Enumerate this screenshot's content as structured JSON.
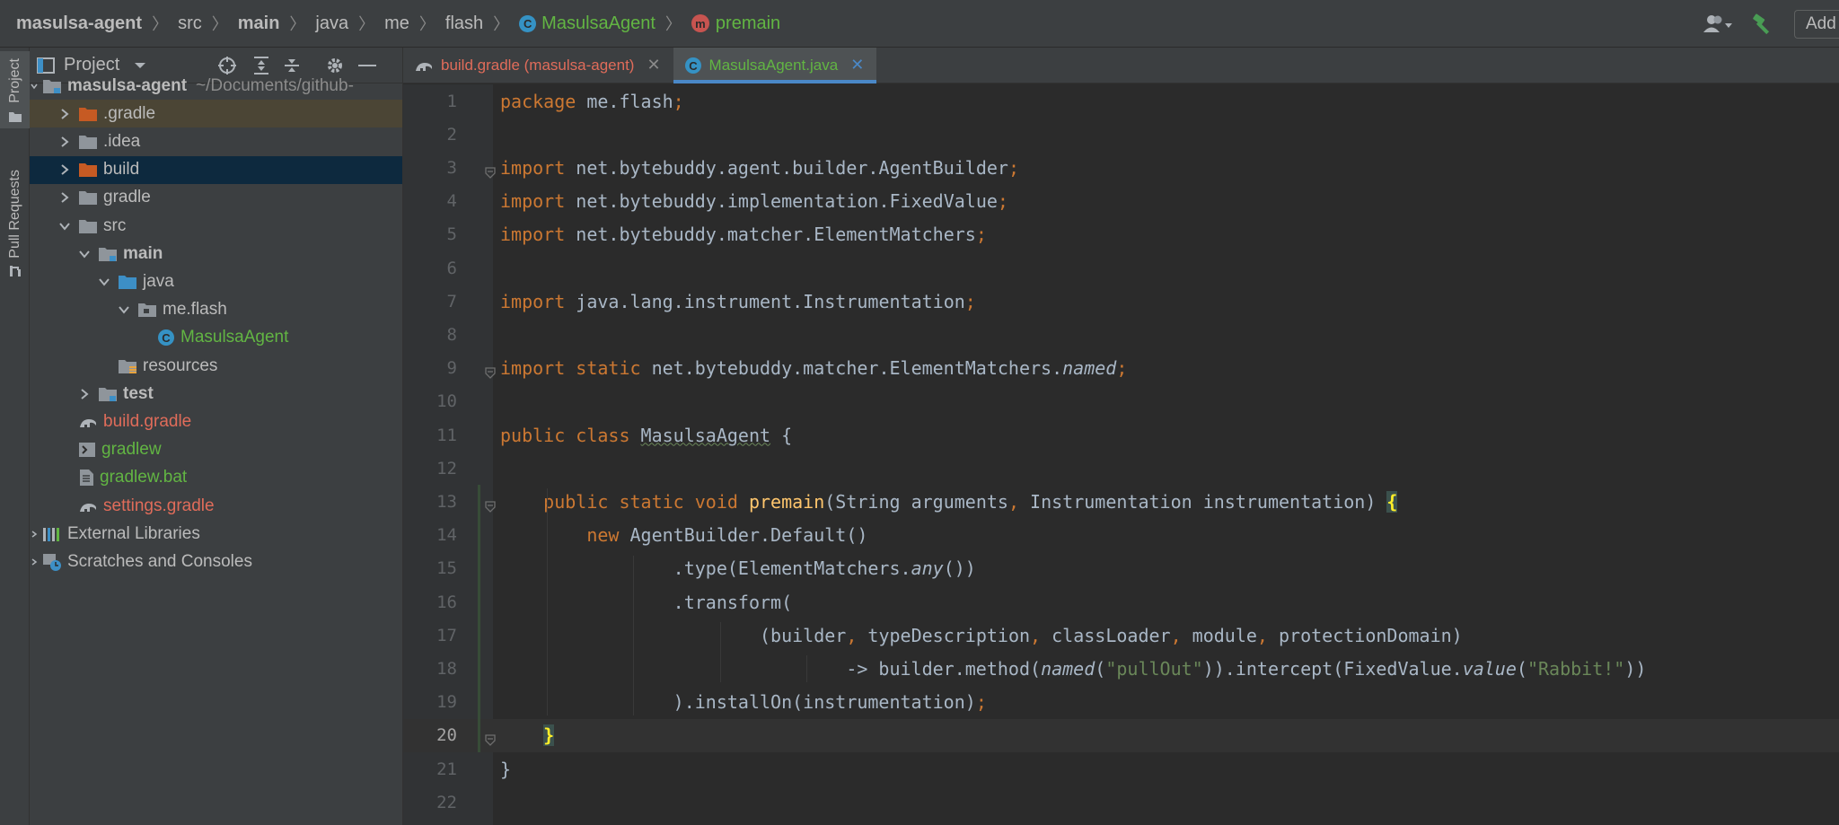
{
  "breadcrumbs": [
    {
      "label": "masulsa-agent",
      "style": "bold"
    },
    {
      "label": "src",
      "style": "normal"
    },
    {
      "label": "main",
      "style": "bold"
    },
    {
      "label": "java",
      "style": "normal"
    },
    {
      "label": "me",
      "style": "normal"
    },
    {
      "label": "flash",
      "style": "normal"
    },
    {
      "label": "MasulsaAgent",
      "style": "class",
      "badge": "C"
    },
    {
      "label": "premain",
      "style": "method",
      "badge": "m"
    }
  ],
  "toolbar": {
    "add_configuration_label": "Add C",
    "user_icon": "user-dropdown-icon",
    "build_icon": "hammer-icon"
  },
  "tool_strip": {
    "project_label": "Project",
    "pull_requests_label": "Pull Requests"
  },
  "project_panel": {
    "title": "Project",
    "tree": [
      {
        "label": "masulsa-agent",
        "sub": "~/Documents/github-",
        "icon": "module-folder",
        "bold": true,
        "arrow": "down-small",
        "indent": 0
      },
      {
        "label": ".gradle",
        "icon": "folder-orange",
        "arrow": "right",
        "indent": 1,
        "selected": "brown"
      },
      {
        "label": ".idea",
        "icon": "folder-gray",
        "arrow": "right",
        "indent": 1
      },
      {
        "label": "build",
        "icon": "folder-orange",
        "arrow": "right",
        "indent": 1,
        "selected": "dark"
      },
      {
        "label": "gradle",
        "icon": "folder-gray",
        "arrow": "right",
        "indent": 1
      },
      {
        "label": "src",
        "icon": "folder-gray",
        "arrow": "down",
        "indent": 1
      },
      {
        "label": "main",
        "icon": "module-folder",
        "arrow": "down",
        "indent": 2,
        "bold": true
      },
      {
        "label": "java",
        "icon": "folder-blue",
        "arrow": "down",
        "indent": 3
      },
      {
        "label": "me.flash",
        "icon": "package",
        "arrow": "down",
        "indent": 4
      },
      {
        "label": "MasulsaAgent",
        "icon": "class",
        "indent": 5,
        "color": "green"
      },
      {
        "label": "resources",
        "icon": "resources-folder",
        "indent": 3
      },
      {
        "label": "test",
        "icon": "module-folder",
        "arrow": "right",
        "indent": 2,
        "bold": true
      },
      {
        "label": "build.gradle",
        "icon": "gradle",
        "indent": 1,
        "color": "red"
      },
      {
        "label": "gradlew",
        "icon": "script",
        "indent": 1,
        "color": "green"
      },
      {
        "label": "gradlew.bat",
        "icon": "bat-file",
        "indent": 1,
        "color": "green"
      },
      {
        "label": "settings.gradle",
        "icon": "gradle",
        "indent": 1,
        "color": "red"
      },
      {
        "label": "External Libraries",
        "icon": "libraries",
        "arrow": "right-small",
        "indent": 0
      },
      {
        "label": "Scratches and Consoles",
        "icon": "scratches",
        "arrow": "right-small",
        "indent": 0
      }
    ]
  },
  "editor": {
    "tabs": [
      {
        "label": "build.gradle (masulsa-agent)",
        "icon": "gradle-icon",
        "color": "red",
        "active": false
      },
      {
        "label": "MasulsaAgent.java",
        "icon": "class-icon",
        "color": "green",
        "active": true
      }
    ],
    "current_line": 20,
    "lines": [
      [
        {
          "t": "package ",
          "c": "kw"
        },
        {
          "t": "me.flash"
        },
        {
          "t": ";",
          "c": "semi"
        }
      ],
      [],
      [
        {
          "t": "import ",
          "c": "kw"
        },
        {
          "t": "net.bytebuddy.agent.builder.AgentBuilder"
        },
        {
          "t": ";",
          "c": "semi"
        }
      ],
      [
        {
          "t": "import ",
          "c": "kw"
        },
        {
          "t": "net.bytebuddy.implementation.FixedValue"
        },
        {
          "t": ";",
          "c": "semi"
        }
      ],
      [
        {
          "t": "import ",
          "c": "kw"
        },
        {
          "t": "net.bytebuddy.matcher.ElementMatchers"
        },
        {
          "t": ";",
          "c": "semi"
        }
      ],
      [],
      [
        {
          "t": "import ",
          "c": "kw"
        },
        {
          "t": "java.lang.instrument.Instrumentation"
        },
        {
          "t": ";",
          "c": "semi"
        }
      ],
      [],
      [
        {
          "t": "import static ",
          "c": "kw"
        },
        {
          "t": "net.bytebuddy.matcher.ElementMatchers."
        },
        {
          "t": "named",
          "c": "it"
        },
        {
          "t": ";",
          "c": "semi"
        }
      ],
      [],
      [
        {
          "t": "public class ",
          "c": "kw"
        },
        {
          "t": "MasulsaAgent",
          "c": "squig"
        },
        {
          "t": " {"
        }
      ],
      [],
      [
        {
          "t": "    "
        },
        {
          "t": "public static void ",
          "c": "kw"
        },
        {
          "t": "premain",
          "c": "fn"
        },
        {
          "t": "(String arguments"
        },
        {
          "t": ", ",
          "c": "semi"
        },
        {
          "t": "Instrumentation instrumentation) "
        },
        {
          "t": "{",
          "c": "brace-hl"
        }
      ],
      [
        {
          "t": "        "
        },
        {
          "t": "new ",
          "c": "kw"
        },
        {
          "t": "AgentBuilder.Default()"
        }
      ],
      [
        {
          "t": "                .type(ElementMatchers."
        },
        {
          "t": "any",
          "c": "it"
        },
        {
          "t": "())"
        }
      ],
      [
        {
          "t": "                .transform("
        }
      ],
      [
        {
          "t": "                        (builder"
        },
        {
          "t": ", ",
          "c": "semi"
        },
        {
          "t": "typeDescription"
        },
        {
          "t": ", ",
          "c": "semi"
        },
        {
          "t": "classLoader"
        },
        {
          "t": ", ",
          "c": "semi"
        },
        {
          "t": "module"
        },
        {
          "t": ", ",
          "c": "semi"
        },
        {
          "t": "protectionDomain)"
        }
      ],
      [
        {
          "t": "                                -> builder.method("
        },
        {
          "t": "named",
          "c": "it"
        },
        {
          "t": "("
        },
        {
          "t": "\"pullOut\"",
          "c": "str"
        },
        {
          "t": ")).intercept(FixedValue."
        },
        {
          "t": "value",
          "c": "it"
        },
        {
          "t": "("
        },
        {
          "t": "\"Rabbit!\"",
          "c": "str"
        },
        {
          "t": "))"
        }
      ],
      [
        {
          "t": "                ).installOn(instrumentation)"
        },
        {
          "t": ";",
          "c": "semi"
        }
      ],
      [
        {
          "t": "    "
        },
        {
          "t": "}",
          "c": "brace-hl"
        }
      ],
      [
        {
          "t": "}"
        }
      ],
      []
    ]
  },
  "colors": {
    "keyword": "#cc7832",
    "function": "#ffc66d",
    "string": "#6a8759",
    "text": "#a9b7c6",
    "accent": "#4a88c7"
  }
}
